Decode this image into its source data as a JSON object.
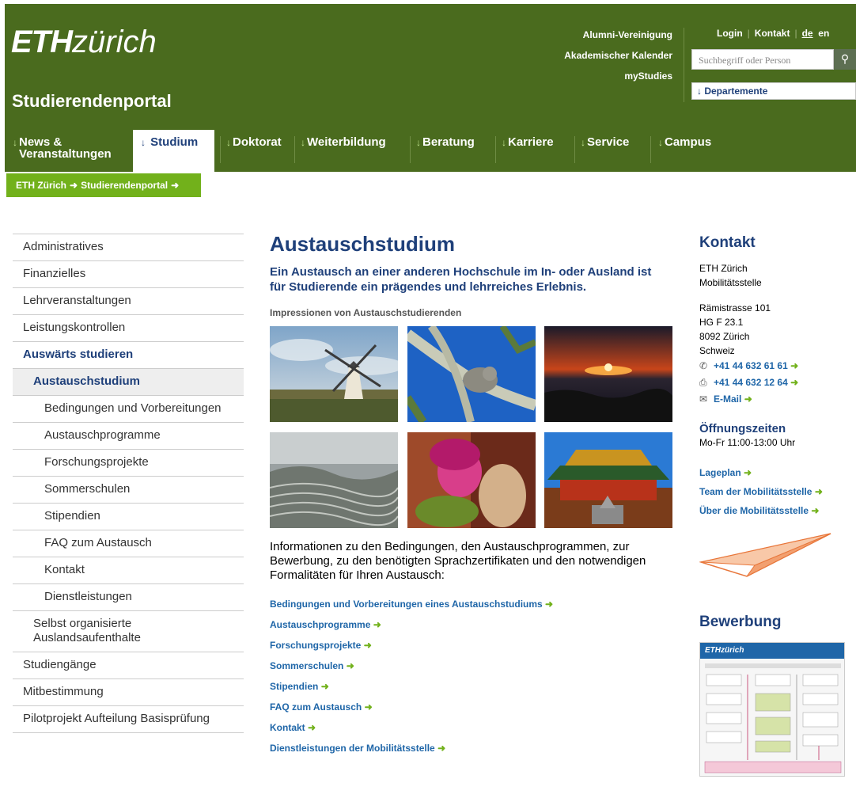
{
  "header": {
    "logo_bold": "ETH",
    "logo_rest": "zürich",
    "portal_title": "Studierendenportal",
    "service_links": [
      "Alumni-Vereinigung",
      "Akademischer Kalender",
      "myStudies"
    ],
    "login": "Login",
    "contact": "Kontakt",
    "lang_de": "de",
    "lang_en": "en",
    "search_placeholder": "Suchbegriff oder Person",
    "departments": "Departemente",
    "accent_color": "#4a6b1e"
  },
  "nav": {
    "items": [
      {
        "label": "News & Veranstaltungen"
      },
      {
        "label": "Studium"
      },
      {
        "label": "Doktorat"
      },
      {
        "label": "Weiterbildung"
      },
      {
        "label": "Beratung"
      },
      {
        "label": "Karriere"
      },
      {
        "label": "Service"
      },
      {
        "label": "Campus"
      }
    ]
  },
  "breadcrumb": {
    "items": [
      "ETH Zürich",
      "Studierendenportal"
    ]
  },
  "sidebar": {
    "items": [
      {
        "label": "Administratives"
      },
      {
        "label": "Finanzielles"
      },
      {
        "label": "Lehrveranstaltungen"
      },
      {
        "label": "Leistungskontrollen"
      },
      {
        "label": "Auswärts studieren"
      },
      {
        "label": "Austauschstudium"
      },
      {
        "label": "Bedingungen und Vorbereitungen"
      },
      {
        "label": "Austauschprogramme"
      },
      {
        "label": "Forschungsprojekte"
      },
      {
        "label": "Sommerschulen"
      },
      {
        "label": "Stipendien"
      },
      {
        "label": "FAQ zum Austausch"
      },
      {
        "label": "Kontakt"
      },
      {
        "label": "Dienstleistungen"
      },
      {
        "label": "Selbst organisierte Auslandsaufenthalte"
      },
      {
        "label": "Studiengänge"
      },
      {
        "label": "Mitbestimmung"
      },
      {
        "label": "Pilotprojekt Aufteilung Basisprüfung"
      }
    ]
  },
  "main": {
    "title": "Austauschstudium",
    "lead": "Ein Austausch an einer anderen Hochschule im In- oder Ausland ist für Studierende ein prägendes und lehrreiches Erlebnis.",
    "gallery_caption": "Impressionen von Austauschstudierenden",
    "description": "Informationen zu den Bedingungen, den Austauschprogrammen, zur Bewerbung, zu den benötigten Sprachzertifikaten und den notwendigen Formalitäten für Ihren Austausch:",
    "links": [
      {
        "label": "Bedingungen und Vorbereitungen eines Austauschstudiums"
      },
      {
        "label": "Austauschprogramme"
      },
      {
        "label": "Forschungsprojekte"
      },
      {
        "label": "Sommerschulen"
      },
      {
        "label": "Stipendien"
      },
      {
        "label": "FAQ zum Austausch"
      },
      {
        "label": "Kontakt"
      },
      {
        "label": "Dienstleistungen der Mobilitätsstelle"
      }
    ]
  },
  "right": {
    "contact_title": "Kontakt",
    "org1": "ETH Zürich",
    "org2": "Mobilitätsstelle",
    "street": "Rämistrasse 101",
    "room": "HG F 23.1",
    "city": "8092 Zürich",
    "country": "Schweiz",
    "phone": "+41 44 632 61 61",
    "fax": "+41 44 632 12 64",
    "email": "E-Mail",
    "hours_title": "Öffnungszeiten",
    "hours": "Mo-Fr 11:00-13:00 Uhr",
    "links": [
      {
        "label": "Lageplan"
      },
      {
        "label": "Team der Mobilitätsstelle"
      },
      {
        "label": "Über die Mobilitätsstelle"
      }
    ],
    "application_title": "Bewerbung",
    "application_logo": "ETHzürich"
  }
}
